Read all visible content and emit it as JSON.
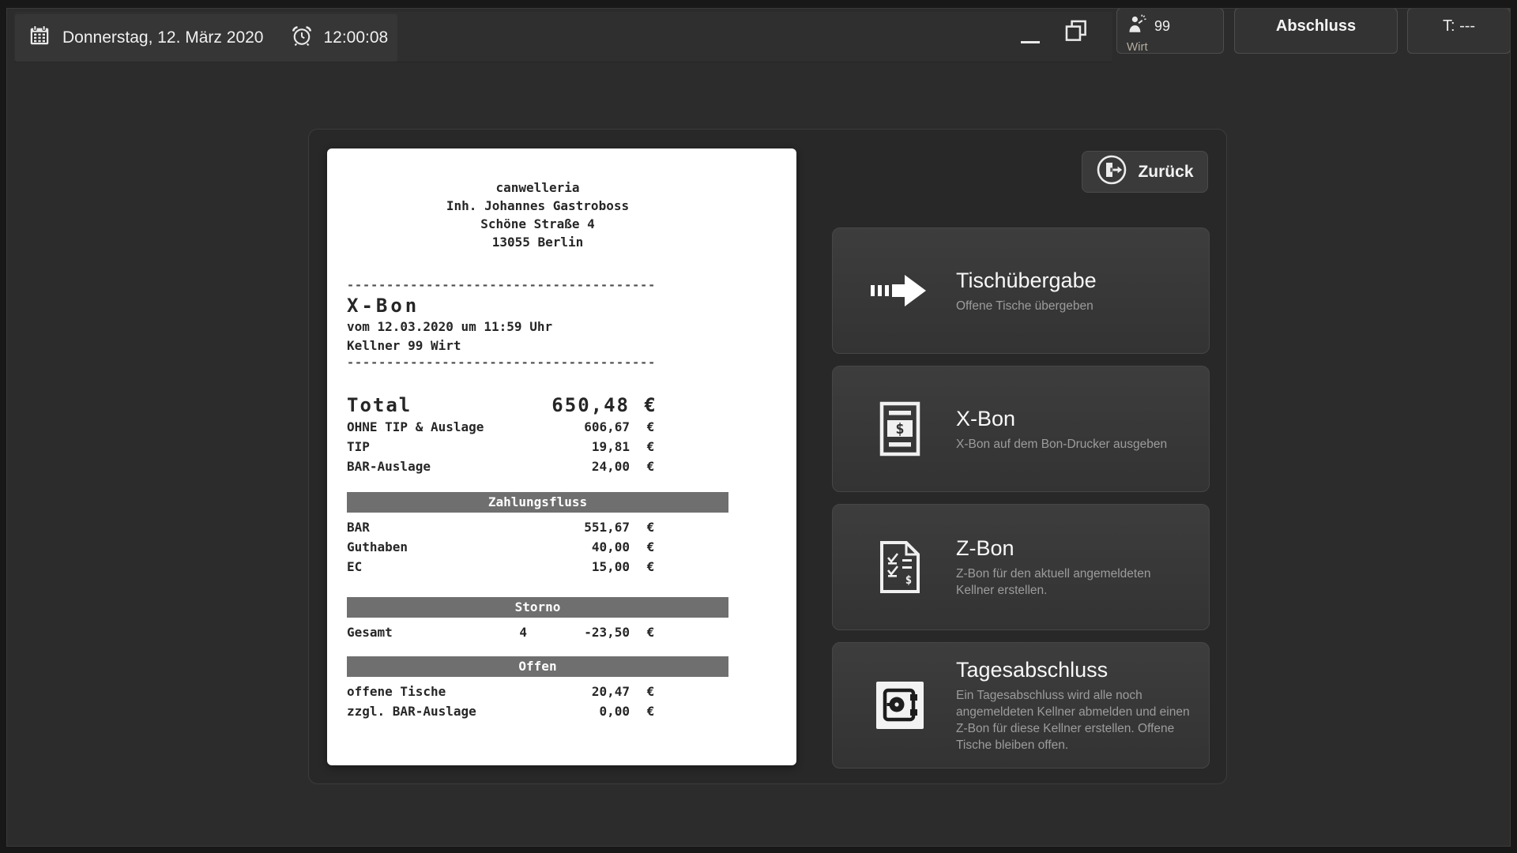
{
  "topbar": {
    "date": "Donnerstag, 12. März 2020",
    "time": "12:00:08",
    "waiter": {
      "number": "99",
      "role": "Wirt"
    },
    "tabs": {
      "abschluss": "Abschluss",
      "table": "T: ---"
    },
    "icons": {
      "calendar": "calendar-icon",
      "clock": "alarm-clock-icon",
      "minimize": "minimize-icon",
      "restore": "restore-window-icon",
      "waiter": "waiter-icon"
    }
  },
  "panel": {
    "back_button": {
      "label": "Zurück",
      "icon": "exit-door-icon"
    },
    "actions": [
      {
        "title": "Tischübergabe",
        "subtitle": "Offene Tische übergeben",
        "icon": "transfer-arrow-icon"
      },
      {
        "title": "X-Bon",
        "subtitle": "X-Bon auf dem Bon-Drucker ausgeben",
        "icon": "receipt-dollar-icon"
      },
      {
        "title": "Z-Bon",
        "subtitle": "Z-Bon für den aktuell angemeldeten Kellner erstellen.",
        "icon": "checklist-document-icon"
      },
      {
        "title": "Tagesabschluss",
        "subtitle": "Ein Tagesabschluss wird alle noch angemeldeten Kellner abmelden und einen Z-Bon für diese Kellner erstellen. Offene Tische bleiben offen.",
        "icon": "safe-icon"
      }
    ]
  },
  "receipt": {
    "header_lines": [
      "canwelleria",
      "Inh. Johannes Gastroboss",
      "Schöne Straße 4",
      "13055 Berlin"
    ],
    "divider": "---------------------------------------",
    "title": "X-Bon",
    "meta_date": "vom 12.03.2020 um 11:59 Uhr",
    "meta_waiter": "Kellner 99 Wirt",
    "total_row": {
      "label": "Total",
      "amount": "650,48",
      "currency": "€"
    },
    "summary_rows": [
      {
        "label": "OHNE TIP & Auslage",
        "amount": "606,67",
        "currency": "€"
      },
      {
        "label": "TIP",
        "amount": "19,81",
        "currency": "€"
      },
      {
        "label": "BAR-Auslage",
        "amount": "24,00",
        "currency": "€"
      }
    ],
    "sections": [
      {
        "title": "Zahlungsfluss",
        "rows": [
          {
            "label": "BAR",
            "amount": "551,67",
            "currency": "€"
          },
          {
            "label": "Guthaben",
            "amount": "40,00",
            "currency": "€"
          },
          {
            "label": "EC",
            "amount": "15,00",
            "currency": "€"
          }
        ]
      },
      {
        "title": "Storno",
        "rows": [
          {
            "label": "Gesamt",
            "qty": "4",
            "amount": "-23,50",
            "currency": "€"
          }
        ]
      },
      {
        "title": "Offen",
        "rows": [
          {
            "label": "offene Tische",
            "amount": "20,47",
            "currency": "€"
          },
          {
            "label": "zzgl. BAR-Auslage",
            "amount": "0,00",
            "currency": "€"
          }
        ]
      }
    ]
  },
  "colors": {
    "window_bg": "#2c2c2c",
    "panel_bg": "#282828",
    "button_bg": "#3a3a3a",
    "receipt_bg": "#ffffff",
    "band_bg": "#6f6f6f",
    "title_text": "#f8f8f8",
    "subtitle_text": "#9c9c9c"
  }
}
